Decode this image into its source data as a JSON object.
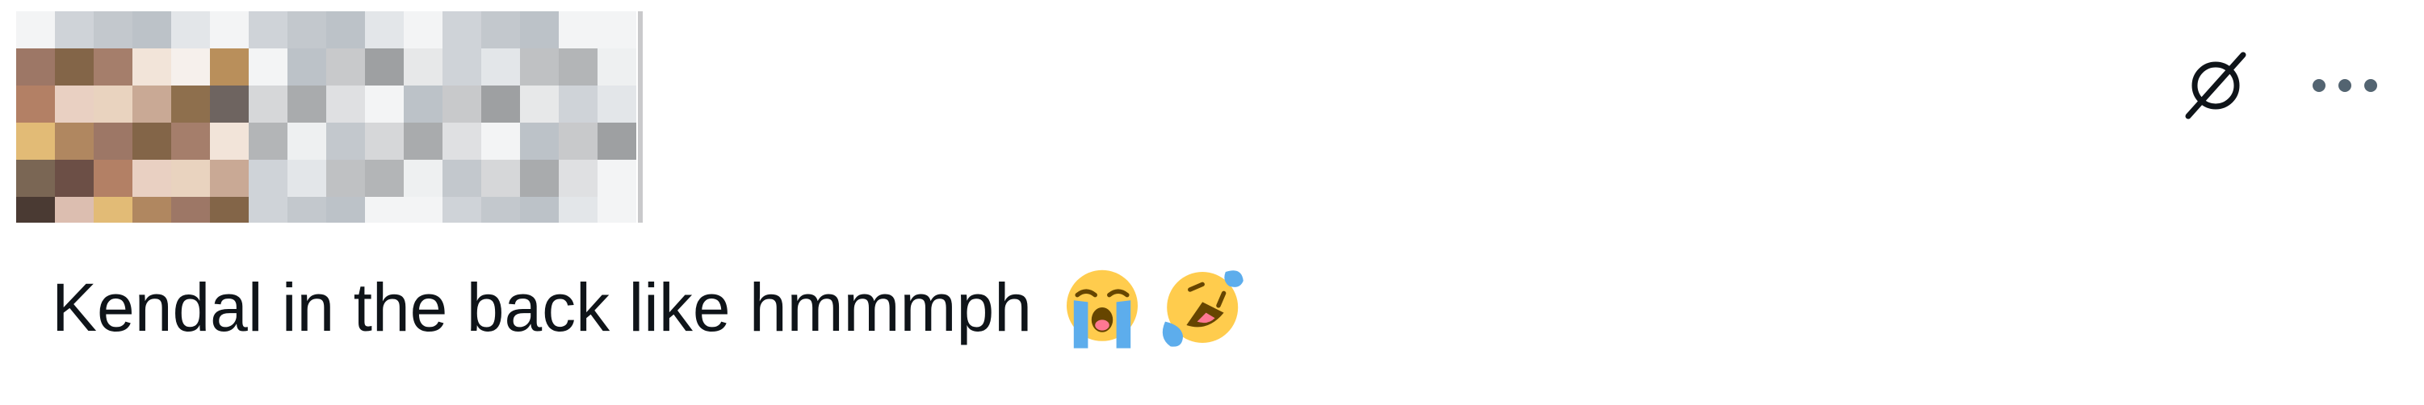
{
  "post": {
    "text": "Kendal in the back like hmmmph",
    "emojis": [
      "loudly-crying-face",
      "rolling-on-the-floor-laughing"
    ]
  },
  "author": {
    "redacted": true
  },
  "actions": {
    "unlink_icon": "slashed-circle-icon",
    "more_icon": "more-dots-icon"
  },
  "colors": {
    "text": "#0f1419",
    "icon": "#0f1419",
    "emoji_yellow": "#ffcc4d",
    "emoji_blue": "#5dadec"
  }
}
